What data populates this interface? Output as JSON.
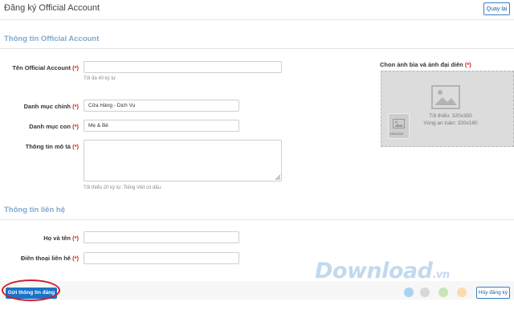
{
  "header": {
    "title": "Đăng ký Official Account",
    "back_label": "Quay lại"
  },
  "section_oa": {
    "title": "Thông tin Official Account",
    "name_label": "Tên Official Account",
    "name_value": "",
    "name_hint": "Tối đa 40 ký tự",
    "main_category_label": "Danh mục chính",
    "main_category_value": "Cửa Hàng - Dịch Vụ",
    "sub_category_label": "Danh mục con",
    "sub_category_value": "Mẹ & Bé",
    "description_label": "Thông tin mô tả",
    "description_value": "",
    "description_hint": "Tối thiểu 20 ký tự. Tiếng Việt có dấu.",
    "required_mark": "(*)"
  },
  "images": {
    "title": "Chon ảnh bìa và ảnh đại diên",
    "required_mark": "(*)",
    "cover_min": "Tối thiểu: 320x350",
    "cover_safe": "Vùng an toàn: 320x180",
    "avatar_size": "150x150"
  },
  "section_contact": {
    "title": "Thông tin liên hệ",
    "fullname_label": "Họ và tên",
    "fullname_value": "",
    "phone_label": "Điên thoại liên hê",
    "phone_value": "",
    "required_mark": "(*)"
  },
  "footer": {
    "submit_label": "Gửi thông tin đăng ký",
    "cancel_label": "Hủy đăng ký"
  },
  "watermark": {
    "text": "Download",
    "suffix": ".vn",
    "dot_colors": [
      "#a8d4f0",
      "#cfcfcf",
      "#bfe3b0",
      "#f7d7a8",
      "#f2a6a6"
    ]
  }
}
